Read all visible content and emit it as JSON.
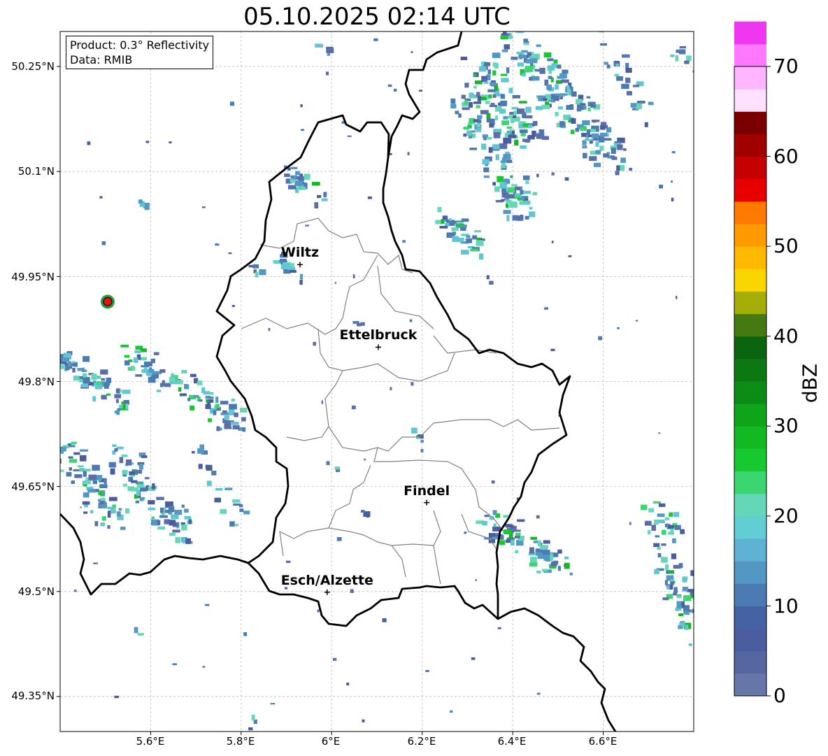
{
  "header": {
    "title": "05.10.2025 02:14 UTC"
  },
  "info": {
    "product": "Product: 0.3° Reflectivity",
    "data": "Data: RMIB"
  },
  "axes": {
    "lat_ticks": [
      "50.25°N",
      "50.1°N",
      "49.95°N",
      "49.8°N",
      "49.65°N",
      "49.5°N",
      "49.35°N"
    ],
    "lon_ticks": [
      "5.6°E",
      "5.8°E",
      "6°E",
      "6.2°E",
      "6.4°E",
      "6.6°E"
    ],
    "lat_range": [
      49.3,
      50.3
    ],
    "lon_range": [
      5.4,
      6.8
    ],
    "grid": true
  },
  "cities": [
    {
      "name": "Wiltz",
      "lon": 5.93,
      "lat": 49.967
    },
    {
      "name": "Ettelbruck",
      "lon": 6.103,
      "lat": 49.849
    },
    {
      "name": "Findel",
      "lon": 6.21,
      "lat": 49.627
    },
    {
      "name": "Esch/Alzette",
      "lon": 5.99,
      "lat": 49.499
    }
  ],
  "radar_site": {
    "lon": 5.505,
    "lat": 49.914,
    "color": "#e81010"
  },
  "colorbar": {
    "label": "dBZ",
    "ticks": [
      "0",
      "10",
      "20",
      "30",
      "40",
      "50",
      "60",
      "70"
    ],
    "range": [
      0,
      70
    ],
    "step": 2.5,
    "colors": [
      "#6676a8",
      "#5666a0",
      "#4a5d9e",
      "#4462a4",
      "#4b7bb2",
      "#5398c4",
      "#5fb2d4",
      "#62cdd2",
      "#64d7b8",
      "#3bd66f",
      "#17c931",
      "#12b922",
      "#0fa51a",
      "#0c8c15",
      "#0b7812",
      "#0a650f",
      "#457a12",
      "#a5ad07",
      "#fbd500",
      "#ffb900",
      "#ff9a00",
      "#ff7a00",
      "#e80000",
      "#c40000",
      "#a00000",
      "#7a0000",
      "#ffe0ff",
      "#ffb6ff",
      "#ff78ff",
      "#ee37ee"
    ]
  }
}
